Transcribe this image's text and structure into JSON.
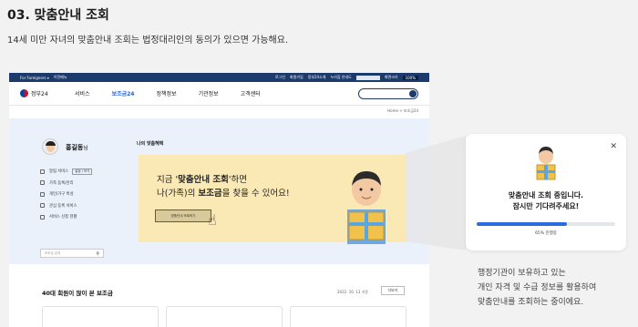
{
  "heading": "03. 맞춤안내 조회",
  "subheading": "14세 미만 자녀의 맞춤안내 조회는 법정대리인의 동의가 있으면 가능해요.",
  "site": {
    "topbar": {
      "foreigners": "For Foreigners ▾",
      "lang": "이전메뉴",
      "links": [
        "로그인",
        "회원가입",
        "정부24소개",
        "누리집 안내도",
        "화면크기"
      ],
      "zoom": "100%"
    },
    "logo": "정부24",
    "menu": [
      "서비스",
      "보조금24",
      "정책정보",
      "기관정보",
      "고객센터"
    ],
    "breadcrumb": "Home > 보조금24",
    "profile": {
      "name": "홍길동",
      "suffix": "님",
      "items": [
        "알림 서비스",
        "가족 등록/관리",
        "개인/가구 특성",
        "관심 등록 서비스",
        "서비스 신청 현황"
      ],
      "alarm_tag": "설정 / 보기",
      "search_placeholder": "보조금 검색"
    },
    "banner": {
      "title": "나의 맞춤혜택",
      "line1_pre": "지금 '",
      "line1_bold": "맞춤안내 조회",
      "line1_post": "'하면",
      "line2_pre": "나(가족)의 ",
      "line2_bold": "보조금",
      "line2_post": "을 찾을 수 있어요!",
      "button": "맞춤안내 조회하기"
    },
    "popular": {
      "title": "40대 회원이 많이 본 보조금",
      "date": "2022. 10. 13 기준",
      "button": "더보기"
    }
  },
  "modal": {
    "line1": "맞춤안내 조회 중입니다.",
    "line2": "잠시만 기다려주세요!",
    "progress_percent": 65,
    "progress_label": "65% 진행중"
  },
  "note": [
    "행정기관이 보유하고 있는",
    "개인 자격 및 수급 정보를 활용하여",
    "맞춤안내를 조회하는 중이에요."
  ],
  "colors": {
    "accent": "#2a6be0",
    "navy": "#1d3a6d",
    "banner": "#fbe9b5"
  }
}
